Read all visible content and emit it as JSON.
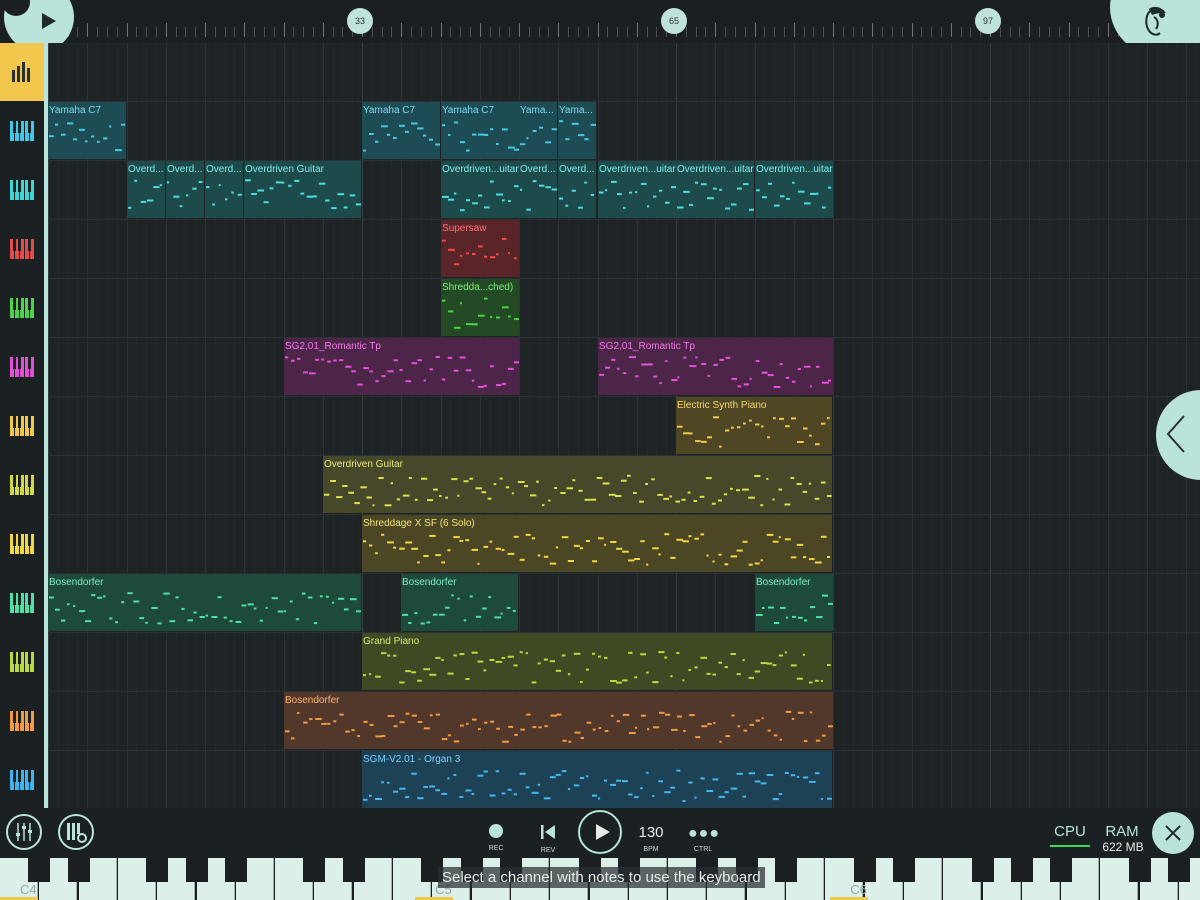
{
  "colors": {
    "accent": "#b9e3db",
    "pattern": "#f1c84b",
    "cpu_meter": "#33dd55"
  },
  "playlist": {
    "bar_markers": [
      "33",
      "65",
      "97"
    ],
    "tracks": [
      {
        "color": "#43c7e6",
        "icon": "piano-keys-icon",
        "clips": [
          {
            "name": "Yamaha C7",
            "start": 1,
            "length": 8,
            "fill": "#1e4c54",
            "text": "#7fdcf0",
            "note": "#46c9e5"
          },
          {
            "name": "Yamaha C7",
            "start": 33,
            "length": 8,
            "fill": "#1e4c54",
            "text": "#7fdcf0",
            "note": "#46c9e5"
          },
          {
            "name": "Yamaha C7",
            "start": 41,
            "length": 8,
            "fill": "#1e4c54",
            "text": "#7fdcf0",
            "note": "#46c9e5"
          },
          {
            "name": "Yama...",
            "start": 49,
            "length": 4,
            "fill": "#1e4c54",
            "text": "#7fdcf0",
            "note": "#46c9e5"
          },
          {
            "name": "Yama...",
            "start": 53,
            "length": 4,
            "fill": "#1e4c54",
            "text": "#7fdcf0",
            "note": "#46c9e5"
          }
        ]
      },
      {
        "color": "#3fd6d6",
        "icon": "piano-keys-icon",
        "clips": [
          {
            "name": "Overd...",
            "start": 9,
            "length": 4,
            "fill": "#1d4a4b",
            "text": "#7feeee",
            "note": "#4ddddd"
          },
          {
            "name": "Overd...",
            "start": 13,
            "length": 4,
            "fill": "#1d4a4b",
            "text": "#7feeee",
            "note": "#4ddddd"
          },
          {
            "name": "Overd...",
            "start": 17,
            "length": 4,
            "fill": "#1d4a4b",
            "text": "#7feeee",
            "note": "#4ddddd"
          },
          {
            "name": "Overdriven Guitar",
            "start": 21,
            "length": 12,
            "fill": "#1d4a4b",
            "text": "#7feeee",
            "note": "#4ddddd"
          },
          {
            "name": "Overdriven...uitar",
            "start": 41,
            "length": 8,
            "fill": "#1d4a4b",
            "text": "#7feeee",
            "note": "#4ddddd"
          },
          {
            "name": "Overd...",
            "start": 49,
            "length": 4,
            "fill": "#1d4a4b",
            "text": "#7feeee",
            "note": "#4ddddd"
          },
          {
            "name": "Overd...",
            "start": 53,
            "length": 4,
            "fill": "#1d4a4b",
            "text": "#7feeee",
            "note": "#4ddddd"
          },
          {
            "name": "Overdriven...uitar",
            "start": 57,
            "length": 8,
            "fill": "#1d4a4b",
            "text": "#7feeee",
            "note": "#4ddddd"
          },
          {
            "name": "Overdriven...uitar",
            "start": 65,
            "length": 8,
            "fill": "#1d4a4b",
            "text": "#7feeee",
            "note": "#4ddddd"
          },
          {
            "name": "Overdriven...uitar",
            "start": 73,
            "length": 8,
            "fill": "#1d4a4b",
            "text": "#7feeee",
            "note": "#4ddddd"
          }
        ]
      },
      {
        "color": "#e64b4b",
        "icon": "piano-keys-icon",
        "clips": [
          {
            "name": "Supersaw",
            "start": 41,
            "length": 8,
            "fill": "#5a2528",
            "text": "#ff7070",
            "note": "#f04a4a"
          }
        ]
      },
      {
        "color": "#4ed34a",
        "icon": "piano-keys-icon",
        "clips": [
          {
            "name": "Shredda...ched)",
            "start": 41,
            "length": 8,
            "fill": "#234a24",
            "text": "#7cf07a",
            "note": "#4ed34a"
          }
        ]
      },
      {
        "color": "#e04fd6",
        "icon": "piano-keys-icon",
        "clips": [
          {
            "name": "SG2,01_Romantic Tp",
            "start": 25,
            "length": 24,
            "fill": "#4d2548",
            "text": "#f07ae8",
            "note": "#e651dd"
          },
          {
            "name": "SG2,01_Romantic Tp",
            "start": 57,
            "length": 24,
            "fill": "#4d2548",
            "text": "#f07ae8",
            "note": "#e651dd"
          }
        ]
      },
      {
        "color": "#f1c84b",
        "icon": "piano-keys-icon",
        "clips": [
          {
            "name": "Electric Synth Piano",
            "start": 65,
            "length": 16,
            "fill": "#4f4624",
            "text": "#f6d873",
            "note": "#f1c84b"
          }
        ]
      },
      {
        "color": "#d3d746",
        "icon": "piano-keys-icon",
        "clips": [
          {
            "name": "Overdriven Guitar",
            "start": 29,
            "length": 52,
            "fill": "#47482a",
            "text": "#e4e97a",
            "note": "#dce24e"
          }
        ]
      },
      {
        "color": "#f1d743",
        "icon": "piano-keys-icon",
        "clips": [
          {
            "name": "Shreddage X SF (6 Solo)",
            "start": 33,
            "length": 48,
            "fill": "#4b4725",
            "text": "#f5e27a",
            "note": "#f1d743"
          }
        ]
      },
      {
        "color": "#4fe0a6",
        "icon": "piano-keys-icon",
        "clips": [
          {
            "name": "Bosendorfer",
            "start": 1,
            "length": 32,
            "fill": "#1d4a3a",
            "text": "#7ff0c2",
            "note": "#4fe0a6"
          },
          {
            "name": "Bosendorfer",
            "start": 37,
            "length": 12,
            "fill": "#1d4a3a",
            "text": "#7ff0c2",
            "note": "#4fe0a6"
          },
          {
            "name": "Bosendorfer",
            "start": 73,
            "length": 8,
            "fill": "#1d4a3a",
            "text": "#7ff0c2",
            "note": "#4fe0a6"
          }
        ]
      },
      {
        "color": "#b9db3f",
        "icon": "piano-keys-icon",
        "clips": [
          {
            "name": "Grand Piano",
            "start": 33,
            "length": 48,
            "fill": "#3d4a24",
            "text": "#d2ee76",
            "note": "#b9db3f"
          }
        ]
      },
      {
        "color": "#f39a45",
        "icon": "piano-keys-icon",
        "clips": [
          {
            "name": "Bosendorfer",
            "start": 25,
            "length": 56,
            "fill": "#52382a",
            "text": "#ffb070",
            "note": "#f39a45"
          }
        ]
      },
      {
        "color": "#3fb5ef",
        "icon": "piano-keys-icon",
        "clips": [
          {
            "name": "SGM-V2.01 - Organ 3",
            "start": 33,
            "length": 48,
            "fill": "#1d4255",
            "text": "#7ad0ff",
            "note": "#45b8f0"
          }
        ]
      }
    ]
  },
  "transport": {
    "rec_label": "REC",
    "rev_label": "REV",
    "bpm_value": "130",
    "bpm_label": "BPM",
    "ctrl_label": "CTRL"
  },
  "status": {
    "cpu_label": "CPU",
    "ram_label": "RAM",
    "ram_value": "622 MB"
  },
  "keyboard": {
    "octave_labels": [
      "C4",
      "C5",
      "C6"
    ],
    "message": "Select a channel with notes to use the keyboard"
  }
}
